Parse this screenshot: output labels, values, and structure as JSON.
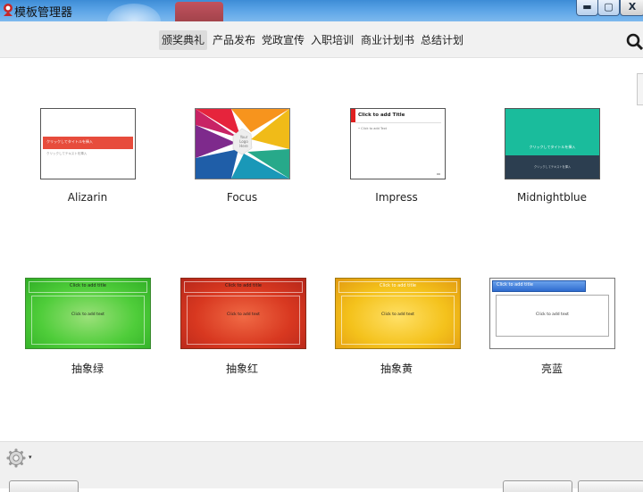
{
  "window": {
    "title": "模板管理器",
    "minimize_label": "▬",
    "maximize_label": "▢",
    "close_label": "X"
  },
  "categories": {
    "tabs": [
      "颁奖典礼",
      "产品发布",
      "党政宣传",
      "入职培训",
      "商业计划书",
      "总结计划"
    ],
    "active_index": 0
  },
  "templates": [
    {
      "name": "Alizarin",
      "thumb": {
        "title": "クリックしてタイトルを挿入",
        "subtitle": "クリックしてテキストを挿入"
      }
    },
    {
      "name": "Focus",
      "thumb": {
        "lines": [
          "Your",
          "Logo",
          "Here"
        ]
      }
    },
    {
      "name": "Impress",
      "thumb": {
        "title": "Click to add Title",
        "body": "• Click to add Text"
      }
    },
    {
      "name": "Midnightblue",
      "thumb": {
        "title": "クリックしてタイトルを挿入",
        "subtitle": "クリックしてテキストを挿入"
      }
    },
    {
      "name": "抽象绿",
      "thumb": {
        "title": "Click to add title",
        "body": "Click to add text"
      }
    },
    {
      "name": "抽象红",
      "thumb": {
        "title": "Click to add title",
        "body": "Click to add text"
      }
    },
    {
      "name": "抽象黄",
      "thumb": {
        "title": "Click to add title",
        "body": "Click to add text"
      }
    },
    {
      "name": "亮蓝",
      "thumb": {
        "title": "Click to add title",
        "body": "Click to add text"
      }
    }
  ],
  "colors": {
    "alizarin_red": "#e74c3c",
    "midnight_teal": "#1abc9c",
    "midnight_dark": "#2c3e50",
    "impress_red": "#e02020",
    "green": "#3fc633",
    "red": "#d83820",
    "yellow": "#f0bb18",
    "blue": "#3a78d8"
  },
  "footer": {
    "settings_icon": "gear-icon",
    "dropdown_glyph": "▾"
  }
}
